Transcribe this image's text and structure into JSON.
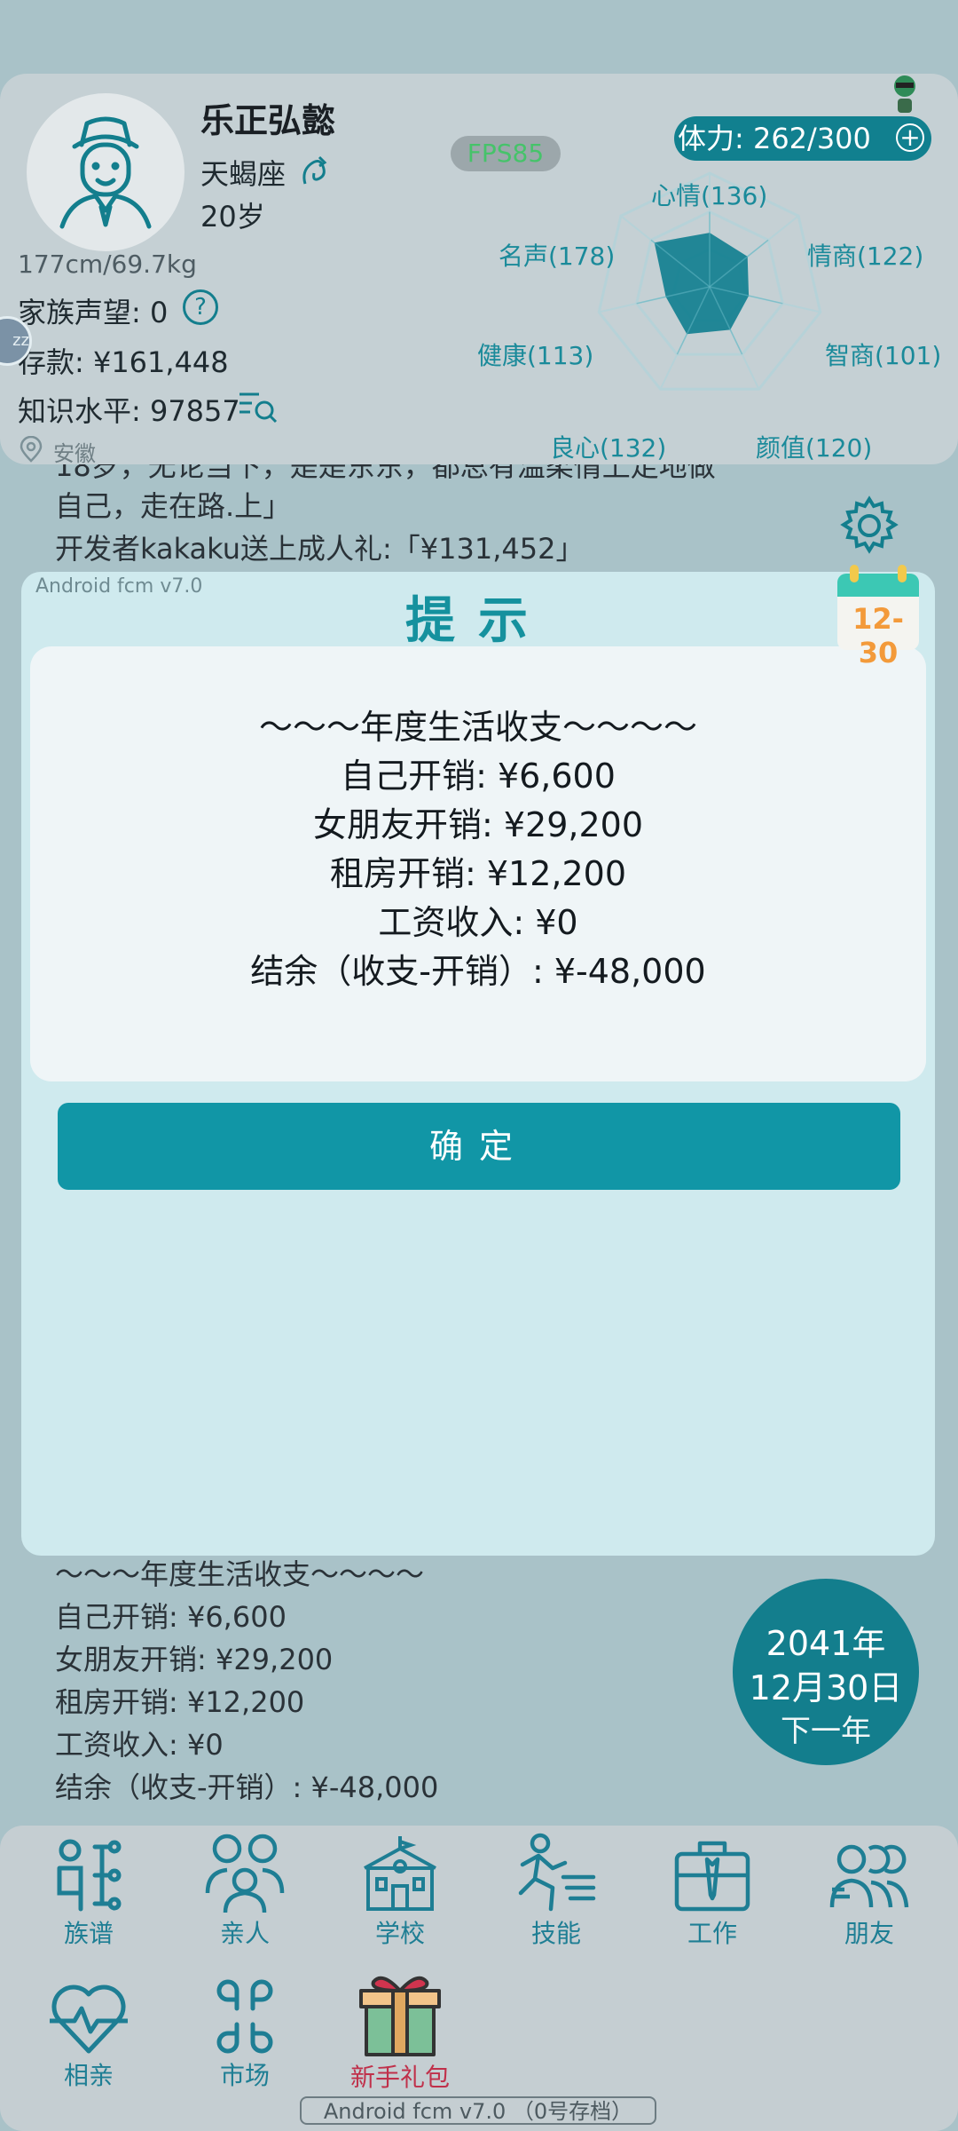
{
  "profile": {
    "name": "乐正弘懿",
    "zodiac": "天蝎座",
    "age": "20岁",
    "height_weight": "177cm/69.7kg",
    "family_reputation": "家族声望: 0",
    "savings": "存款: ¥161,448",
    "knowledge": "知识水平: 97857",
    "location": "安徽",
    "fps": "FPS85",
    "stamina": "体力: 262/300"
  },
  "radar": {
    "labels": [
      "心情(136)",
      "情商(122)",
      "智商(101)",
      "颜值(120)",
      "良心(132)",
      "健康(113)",
      "名声(178)"
    ],
    "values": [
      136,
      122,
      101,
      120,
      132,
      113,
      178
    ],
    "fill_color": "#127f90"
  },
  "log": {
    "partial_line": "18岁，无论当下，是是东东，都总有温柔情上走地做",
    "line1": "自己，走在路.上」",
    "line2": "开发者kakaku送上成人礼:「¥131,452」",
    "summary_lines": [
      "～～～年度生活收支～～～～",
      "自己开销: ¥6,600",
      "女朋友开销: ¥29,200",
      "租房开销: ¥12,200",
      "工资收入: ¥0",
      "结余（收支-开销）: ¥-48,000"
    ]
  },
  "calendar": {
    "date": "12-30"
  },
  "modal": {
    "version": "Android fcm v7.0",
    "title": "提示",
    "lines": [
      "～～～年度生活收支～～～～",
      "自己开销: ¥6,600",
      "女朋友开销: ¥29,200",
      "租房开销: ¥12,200",
      "工资收入: ¥0",
      "结余（收支-开销）: ¥-48,000"
    ],
    "confirm": "确定"
  },
  "date_circle": {
    "year": "2041年",
    "day": "12月30日",
    "next": "下一年"
  },
  "nav": {
    "items": [
      "族谱",
      "亲人",
      "学校",
      "技能",
      "工作",
      "朋友",
      "相亲",
      "市场",
      "新手礼包"
    ],
    "gift_color": "#c0304a"
  },
  "footer": {
    "version": "Android fcm v7.0 （0号存档）"
  },
  "colors": {
    "accent": "#1196a6",
    "background": "#a9c2c8"
  }
}
